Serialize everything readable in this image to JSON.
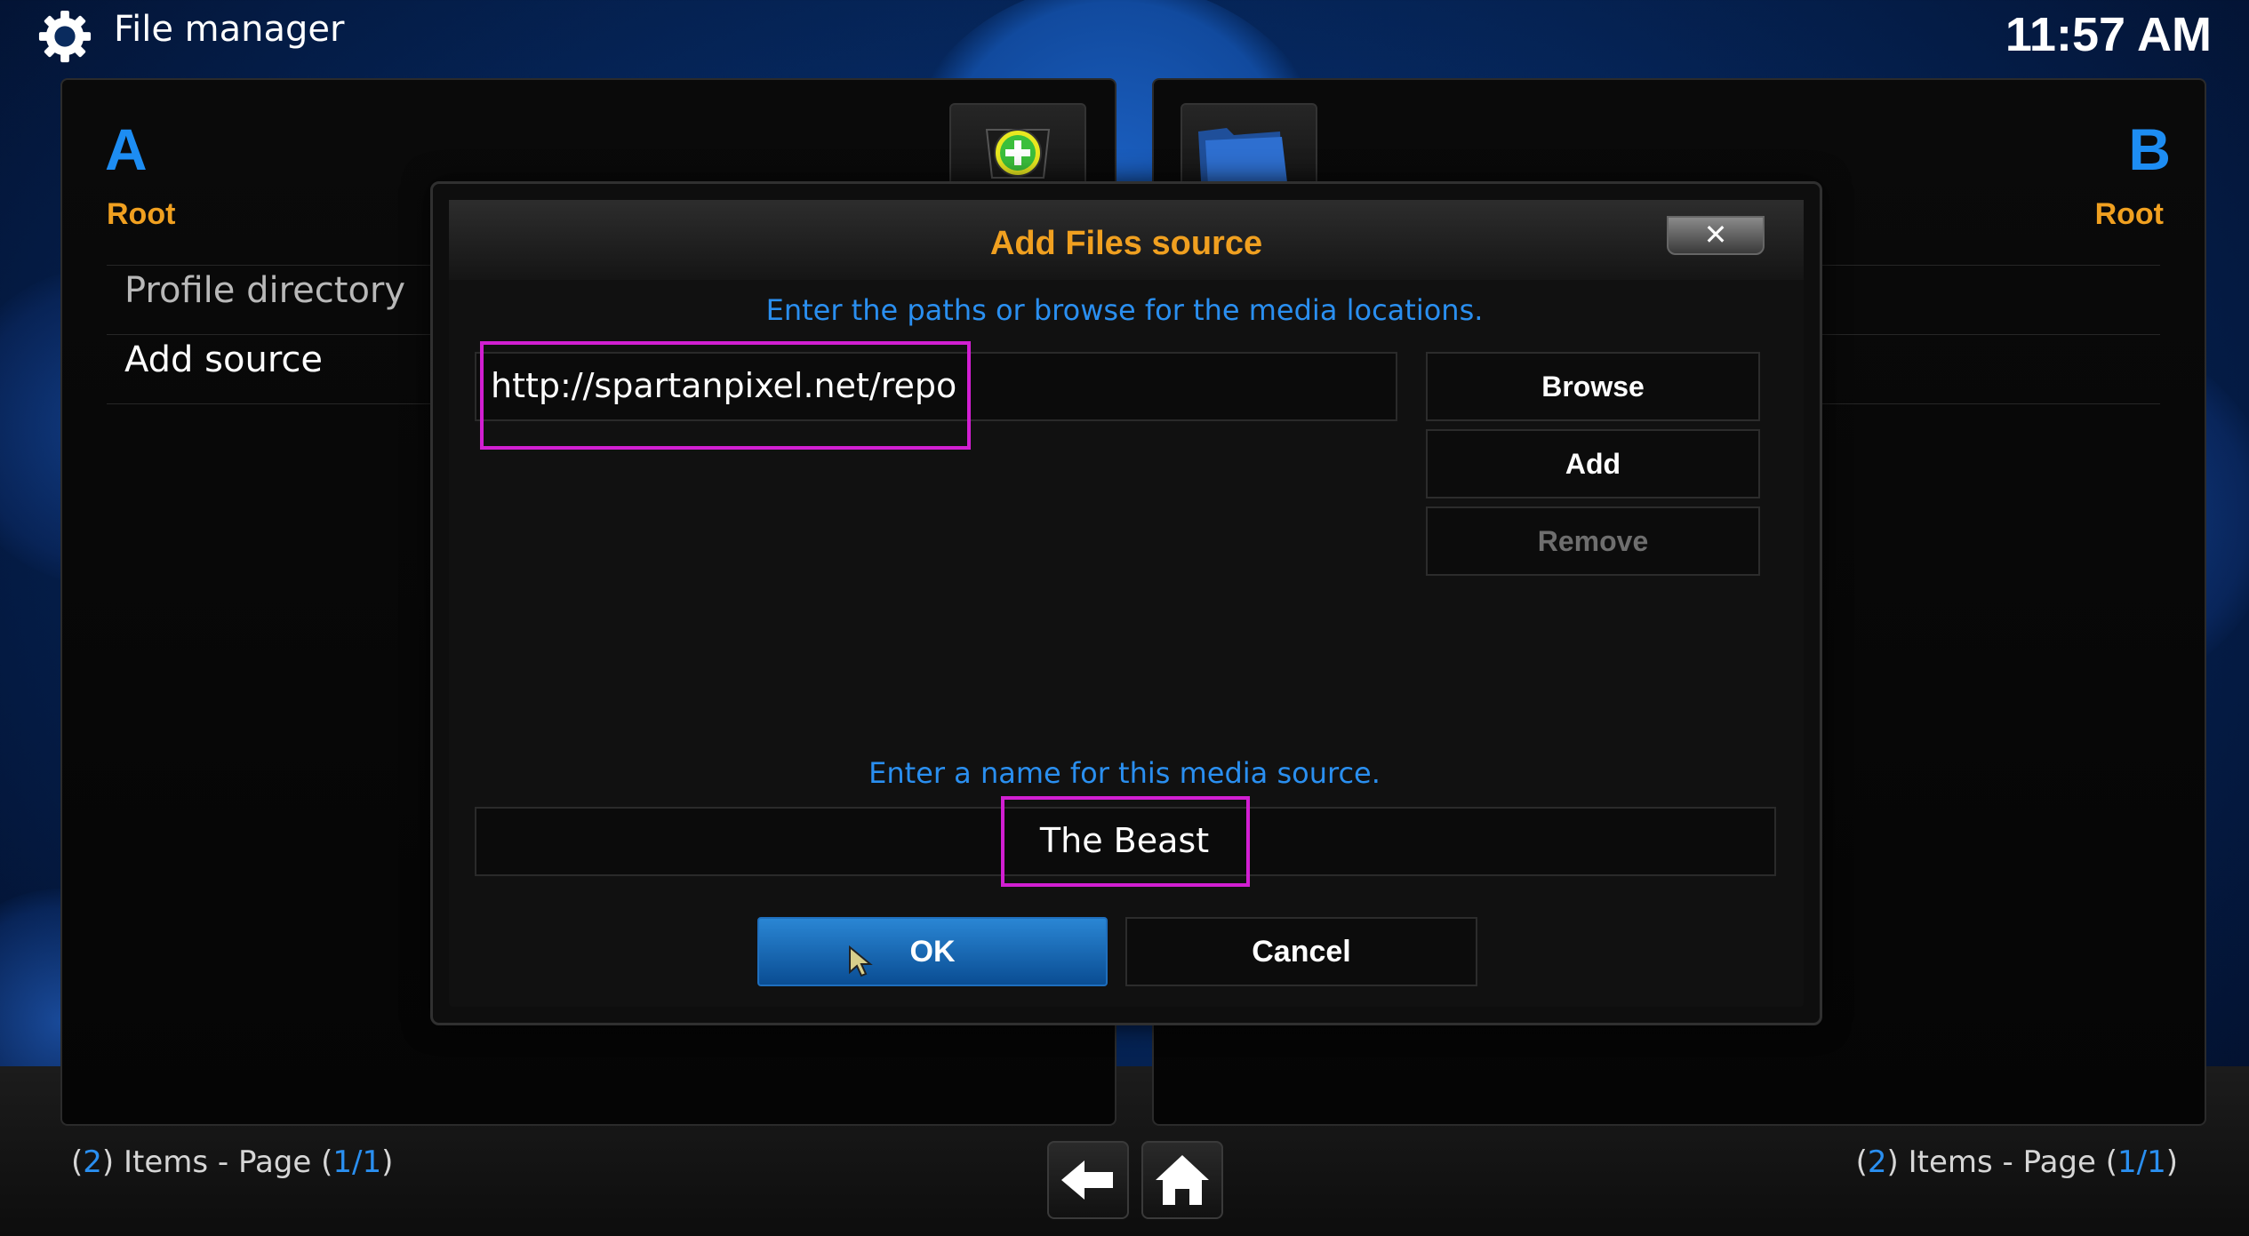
{
  "header": {
    "title": "File manager",
    "clock": "11:57 AM"
  },
  "panel_a": {
    "letter": "A",
    "subtitle": "Root",
    "items": [
      {
        "label": "Profile directory"
      },
      {
        "label": "Add source"
      }
    ],
    "footer": {
      "count": "2",
      "items_text": "Items - Page",
      "page": "1/1"
    }
  },
  "panel_b": {
    "letter": "B",
    "subtitle": "Root",
    "footer": {
      "count": "2",
      "items_text": "Items - Page",
      "page": "1/1"
    }
  },
  "dialog": {
    "title": "Add Files source",
    "close_label": "✕",
    "paths_instruction": "Enter the paths or browse for the media locations.",
    "path_value": "http://spartanpixel.net/repo",
    "buttons": {
      "browse": "Browse",
      "add": "Add",
      "remove": "Remove"
    },
    "name_instruction": "Enter a name for this media source.",
    "name_value": "The Beast",
    "ok_label": "OK",
    "cancel_label": "Cancel"
  },
  "colors": {
    "accent_blue": "#1d8df3",
    "accent_orange": "#f0a020",
    "highlight_magenta": "#d21fd2"
  }
}
